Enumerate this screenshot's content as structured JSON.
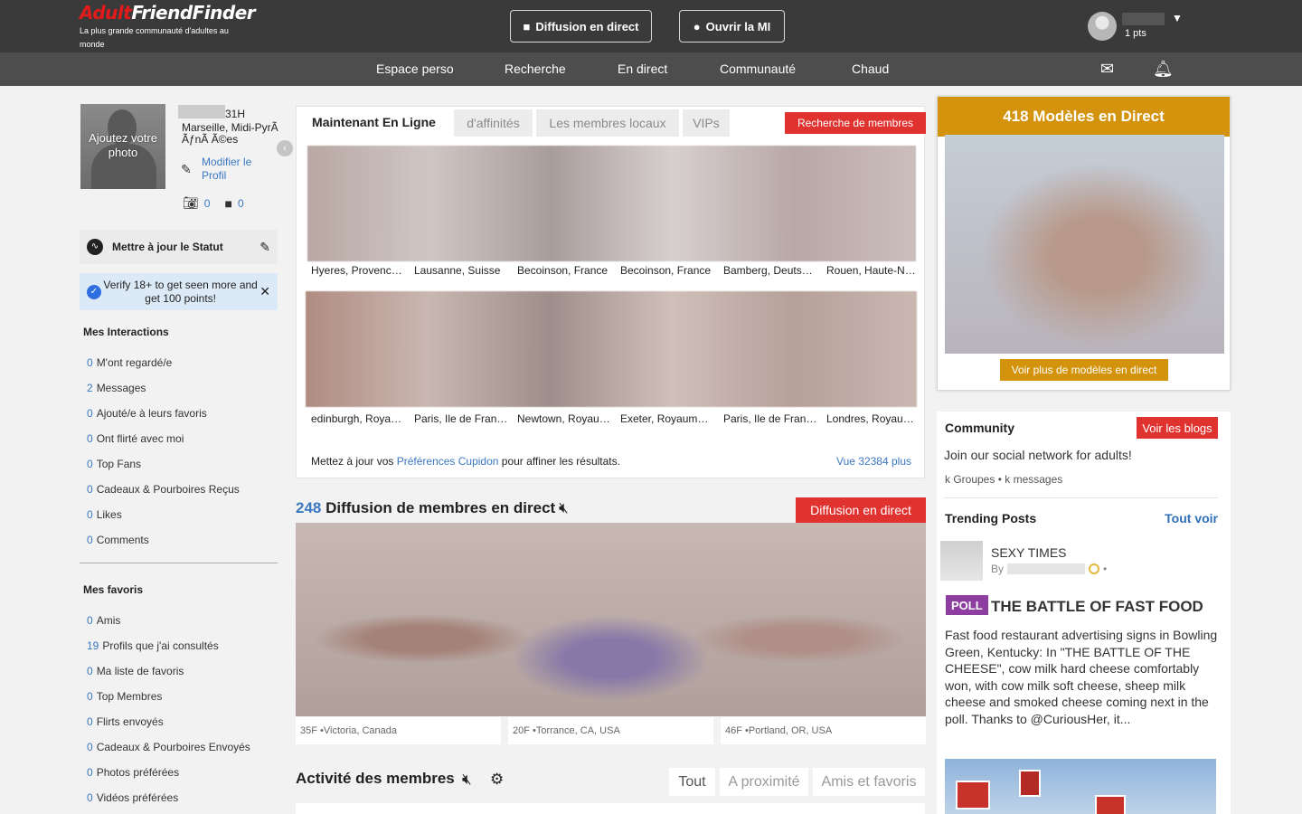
{
  "header": {
    "logo_part1": "Adult",
    "logo_part2": "FriendFinder",
    "tagline": "La plus grande communauté d'adultes au monde",
    "live_button": "Diffusion en direct",
    "im_button": "Ouvrir la MI",
    "points": "1 pts"
  },
  "nav": {
    "items": [
      "Espace perso",
      "Recherche",
      "En direct",
      "Communauté",
      "Chaud"
    ]
  },
  "profile": {
    "add_photo": "Ajoutez votre photo",
    "age_sex": "31H",
    "location": "Marseille, Midi-PyrÃ  ÃƒnÃ  Ã©es",
    "edit_profile": "Modifier le Profil",
    "photo_count": "0",
    "video_count": "0"
  },
  "status": {
    "label": "Mettre à jour le Statut"
  },
  "verify": {
    "text": "Verify 18+ to get seen more and get 100 points!"
  },
  "interactions": {
    "title": "Mes Interactions",
    "items": [
      {
        "count": "0",
        "label": "M'ont regardé/e"
      },
      {
        "count": "2",
        "label": "Messages"
      },
      {
        "count": "0",
        "label": "Ajouté/e à leurs favoris"
      },
      {
        "count": "0",
        "label": "Ont flirté avec moi"
      },
      {
        "count": "0",
        "label": "Top Fans"
      },
      {
        "count": "0",
        "label": "Cadeaux & Pourboires Reçus"
      },
      {
        "count": "0",
        "label": "Likes"
      },
      {
        "count": "0",
        "label": "Comments"
      }
    ]
  },
  "favorites": {
    "title": "Mes favoris",
    "items": [
      {
        "count": "0",
        "label": "Amis"
      },
      {
        "count": "19",
        "label": "Profils que j'ai consultés"
      },
      {
        "count": "0",
        "label": "Ma liste de favoris"
      },
      {
        "count": "0",
        "label": "Top Membres"
      },
      {
        "count": "0",
        "label": "Flirts envoyés"
      },
      {
        "count": "0",
        "label": "Cadeaux & Pourboires Envoyés"
      },
      {
        "count": "0",
        "label": "Photos préférées"
      },
      {
        "count": "0",
        "label": "Vidéos préférées"
      }
    ]
  },
  "online": {
    "tabs": [
      "Maintenant En Ligne",
      "d'affinités",
      "Les membres locaux",
      "VIPs"
    ],
    "search_button": "Recherche de membres",
    "row1": [
      "Hyeres, Provence-Alpes",
      "Lausanne, Suisse",
      "Becoinson, France",
      "Becoinson, France",
      "Bamberg, Deutschland",
      "Rouen, Haute-Normandie"
    ],
    "row2": [
      "edinburgh, Royaume-Uni",
      "Paris, Ile de France",
      "Newtown, Royaume-Uni",
      "Exeter, Royaume-Uni",
      "Paris, Ile de France",
      "Londres, Royaume-Uni"
    ],
    "cupid_prefix": "Mettez à jour vos ",
    "cupid_link": "Préférences Cupidon",
    "cupid_suffix": " pour affiner les résultats.",
    "view_more": "Vue 32384 plus"
  },
  "live": {
    "count": "248",
    "title": " Diffusion de membres en direct",
    "button": "Diffusion en direct",
    "cards": [
      "35F •Victoria, Canada",
      "20F •Torrance, CA, USA",
      "46F •Portland, OR, USA"
    ]
  },
  "activity": {
    "title": "Activité des membres",
    "tabs": [
      "Tout",
      "A proximité",
      "Amis et favoris"
    ]
  },
  "models": {
    "title": "418 Modèles en Direct",
    "button": "Voir plus de modèles en direct"
  },
  "community": {
    "title": "Community",
    "blogs_button": "Voir les blogs",
    "subtitle": "Join our social network for adults!",
    "groups": "k Groupes",
    "messages": "k messages",
    "trending_title": "Trending Posts",
    "see_all": "Tout voir",
    "post1_title": "SEXY TIMES",
    "post1_by": "By",
    "poll_badge": "POLL",
    "poll_title": "THE BATTLE OF FAST FOOD",
    "poll_desc": "Fast food restaurant advertising signs in Bowling Green, Kentucky: In \"THE BATTLE OF THE CHEESE\", cow milk hard cheese comfortably won, with cow milk soft cheese, sheep milk cheese and smoked cheese coming next in the poll. Thanks to @CuriousHer, it..."
  }
}
